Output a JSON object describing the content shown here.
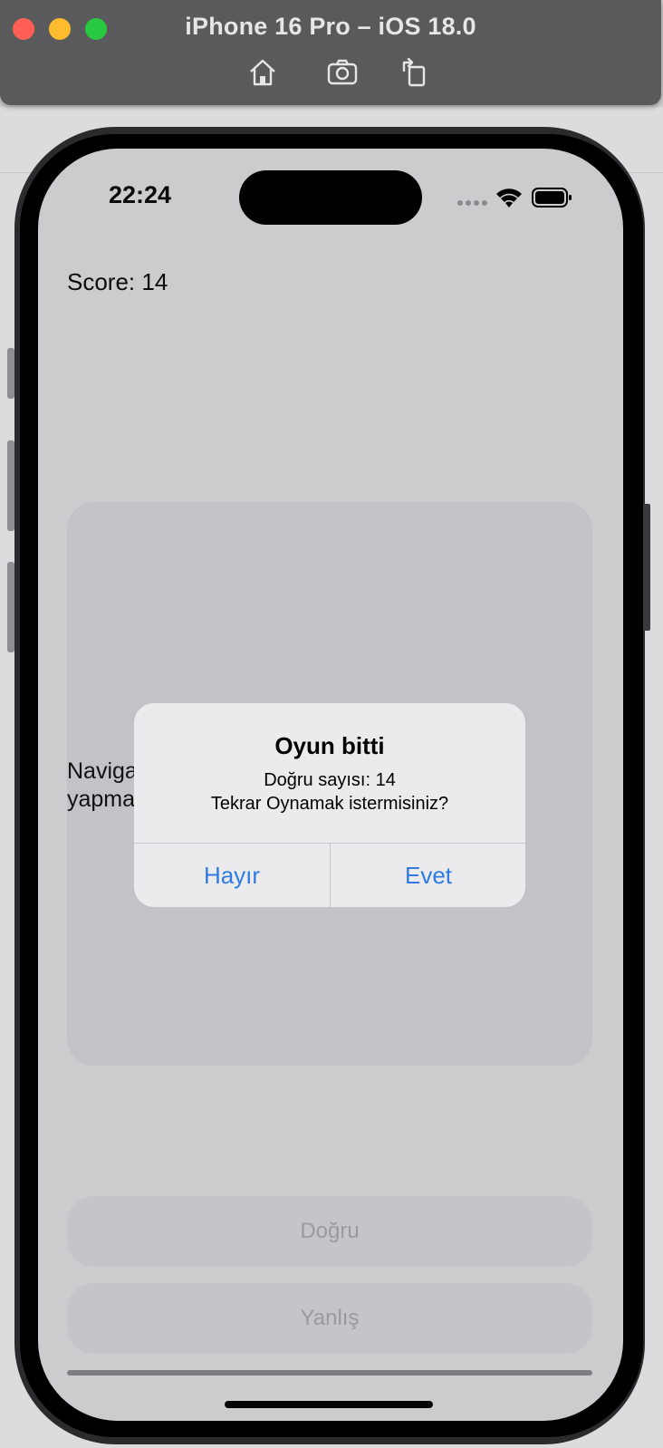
{
  "window": {
    "title": "iPhone 16 Pro – iOS 18.0",
    "toolbar": [
      "home-icon",
      "screenshot-icon",
      "rotate-icon"
    ]
  },
  "status_bar": {
    "time": "22:24"
  },
  "game": {
    "score": "Score: 14",
    "card_text_line1": "Naviga",
    "card_text_line2": "yapma",
    "button_correct": "Doğru",
    "button_wrong": "Yanlış"
  },
  "alert": {
    "title": "Oyun bitti",
    "message_line1": "Doğru sayısı: 14",
    "message_line2": "Tekrar Oynamak istermisiniz?",
    "button_no": "Hayır",
    "button_yes": "Evet"
  },
  "colors": {
    "accent": "#2f7be0",
    "close": "#ff5f57",
    "minimize": "#febc2e",
    "zoom": "#28c840"
  }
}
